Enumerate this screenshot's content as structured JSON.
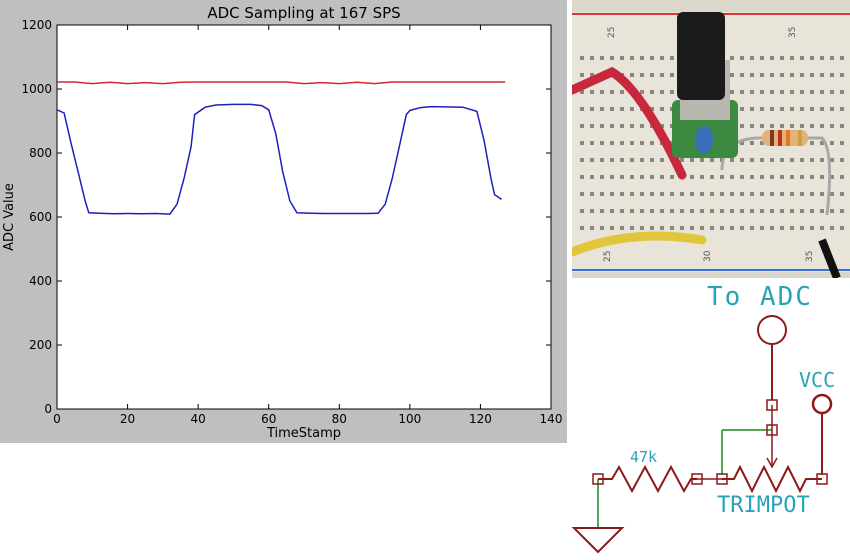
{
  "chart_data": {
    "type": "line",
    "title": "ADC Sampling at 167 SPS",
    "xlabel": "TimeStamp",
    "ylabel": "ADC Value",
    "xlim": [
      0,
      140
    ],
    "ylim": [
      0,
      1200
    ],
    "xticks": [
      "0",
      "20",
      "40",
      "60",
      "80",
      "100",
      "120",
      "140"
    ],
    "yticks": [
      "0",
      "200",
      "400",
      "600",
      "800",
      "1000",
      "1200"
    ],
    "grid": false,
    "legend": "none",
    "series": [
      {
        "color": "#d62728",
        "x": [
          0,
          5,
          10,
          15,
          20,
          25,
          30,
          35,
          40,
          45,
          50,
          55,
          60,
          65,
          70,
          75,
          80,
          85,
          90,
          95,
          100,
          105,
          110,
          115,
          120,
          125,
          127
        ],
        "y": [
          1022,
          1022,
          1017,
          1021,
          1017,
          1020,
          1017,
          1021,
          1022,
          1022,
          1022,
          1022,
          1022,
          1022,
          1017,
          1020,
          1017,
          1021,
          1017,
          1022,
          1022,
          1022,
          1022,
          1022,
          1022,
          1022,
          1022
        ]
      },
      {
        "color": "#1f1fbf",
        "x": [
          0,
          2,
          4,
          6,
          8,
          9,
          12,
          16,
          20,
          24,
          28,
          32,
          34,
          36,
          38,
          39,
          42,
          45,
          50,
          55,
          58,
          60,
          62,
          64,
          66,
          68,
          72,
          76,
          80,
          84,
          88,
          91,
          93,
          95,
          97,
          99,
          100,
          103,
          106,
          110,
          115,
          119,
          121,
          123,
          124,
          126
        ],
        "y": [
          935,
          925,
          830,
          740,
          650,
          613,
          612,
          610,
          611,
          610,
          611,
          609,
          640,
          720,
          820,
          920,
          943,
          950,
          952,
          952,
          948,
          935,
          860,
          740,
          650,
          613,
          612,
          611,
          611,
          611,
          611,
          612,
          640,
          720,
          820,
          920,
          933,
          942,
          945,
          944,
          943,
          930,
          840,
          720,
          670,
          655
        ]
      }
    ]
  },
  "schematic": {
    "adc_label": "To ADC",
    "vcc_label": "VCC",
    "resistor_label": "47k",
    "trimpot_label": "TRIMPOT"
  },
  "photo": {
    "ruler_labels": [
      "25",
      "30",
      "35"
    ]
  }
}
